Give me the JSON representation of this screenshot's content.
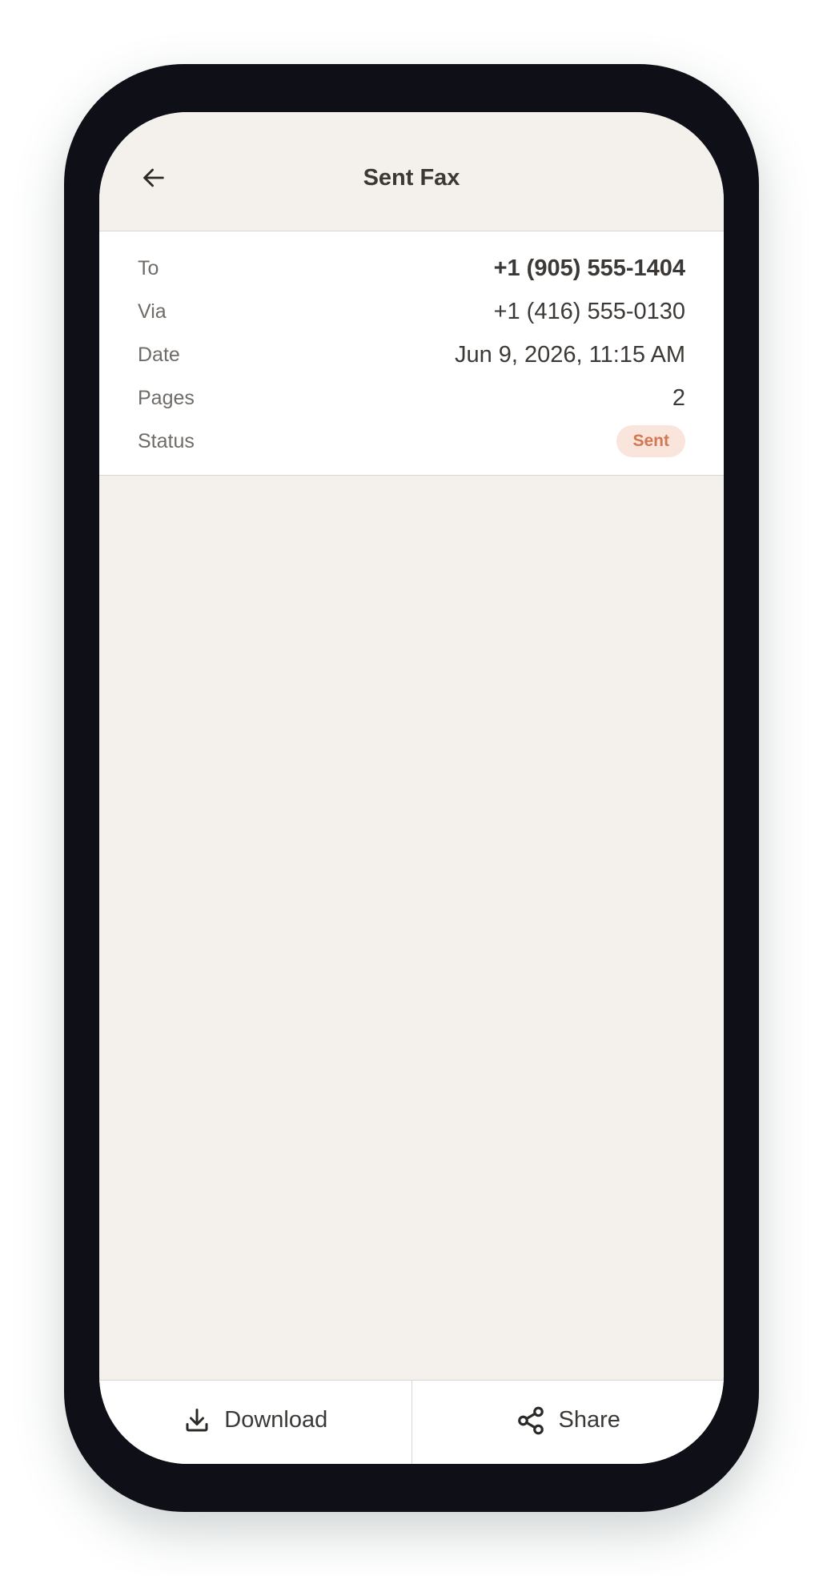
{
  "header": {
    "title": "Sent Fax",
    "back_icon": "arrow-left-icon"
  },
  "details": {
    "rows": [
      {
        "label": "To",
        "value": "+1 (905) 555-1404"
      },
      {
        "label": "Via",
        "value": "+1 (416) 555-0130"
      },
      {
        "label": "Date",
        "value": "Jun 9, 2026, 11:15 AM"
      },
      {
        "label": "Pages",
        "value": "2"
      },
      {
        "label": "Status",
        "value": "Sent"
      }
    ]
  },
  "actions": {
    "download_label": "Download",
    "download_icon": "download-icon",
    "share_label": "Share",
    "share_icon": "share-icon"
  },
  "colors": {
    "background": "#f4f1ed",
    "frame": "#0f1017",
    "status_badge_bg": "#f9e5dc",
    "status_badge_text": "#d27852",
    "text_primary": "#3b3835",
    "text_secondary": "#6f6b67"
  }
}
